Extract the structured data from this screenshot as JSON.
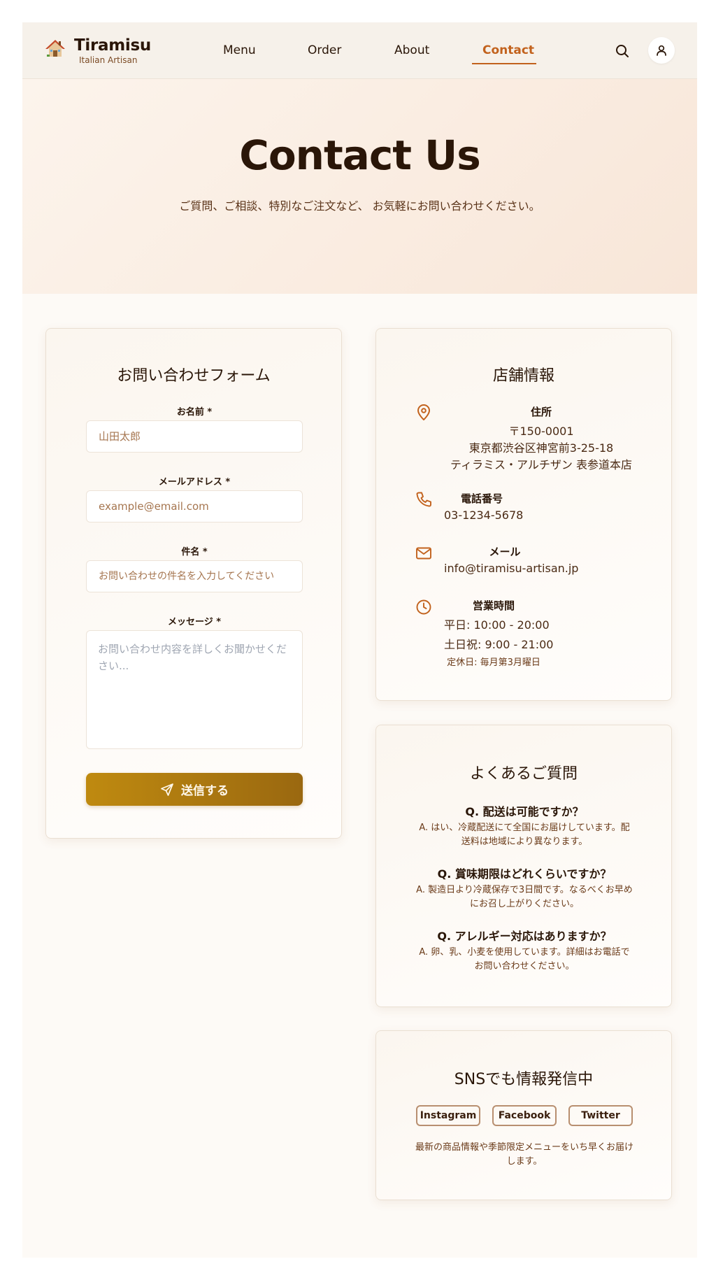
{
  "brand": {
    "name": "Tiramisu",
    "tagline": "Italian Artisan",
    "logo_icon": "house-icon"
  },
  "nav": {
    "items": [
      {
        "label": "Menu"
      },
      {
        "label": "Order"
      },
      {
        "label": "About"
      },
      {
        "label": "Contact",
        "active": true
      }
    ]
  },
  "hero": {
    "title": "Contact Us",
    "subtitle": "ご質問、ご相談、特別なご注文など、 お気軽にお問い合わせください。"
  },
  "form": {
    "title": "お問い合わせフォーム",
    "fields": [
      {
        "label": "お名前 *",
        "placeholder": "山田太郎",
        "value": ""
      },
      {
        "label": "メールアドレス *",
        "placeholder": "example@email.com",
        "value": ""
      },
      {
        "label": "件名 *",
        "placeholder": "お問い合わせの件名を入力してください",
        "value": ""
      },
      {
        "label": "メッセージ *",
        "placeholder": "お問い合わせ内容を詳しくお聞かせください...",
        "value": ""
      }
    ],
    "submit_label": "送信する"
  },
  "store_info": {
    "title": "店舗情報",
    "address": {
      "label": "住所",
      "lines": [
        "〒150-0001",
        "東京都渋谷区神宮前3-25-18",
        "ティラミス・アルチザン 表参道本店"
      ]
    },
    "phone": {
      "label": "電話番号",
      "value": "03-1234-5678"
    },
    "email": {
      "label": "メール",
      "value": "info@tiramisu-artisan.jp"
    },
    "hours": {
      "label": "営業時間",
      "weekday": "平日: 10:00 - 20:00",
      "weekend": "土日祝: 9:00 - 21:00",
      "closed": "定休日: 毎月第3月曜日"
    }
  },
  "faq": {
    "title": "よくあるご質問",
    "items": [
      {
        "q": "Q. 配送は可能ですか？",
        "a": "A. はい、冷蔵配送にて全国にお届けしています。配送料は地域により異なります。"
      },
      {
        "q": "Q. 賞味期限はどれくらいですか？",
        "a": "A. 製造日より冷蔵保存で3日間です。なるべくお早めにお召し上がりください。"
      },
      {
        "q": "Q. アレルギー対応はありますか？",
        "a": "A. 卵、乳、小麦を使用しています。詳細はお電話でお問い合わせください。"
      }
    ]
  },
  "sns": {
    "title": "SNSでも情報発信中",
    "links": [
      {
        "label": "Instagram"
      },
      {
        "label": "Facebook"
      },
      {
        "label": "Twitter"
      }
    ],
    "note": "最新の商品情報や季節限定メニューをいち早くお届けします。"
  },
  "colors": {
    "accent": "#c2621d",
    "brand_dark": "#2a1608",
    "button_gold": "#b0800f"
  }
}
